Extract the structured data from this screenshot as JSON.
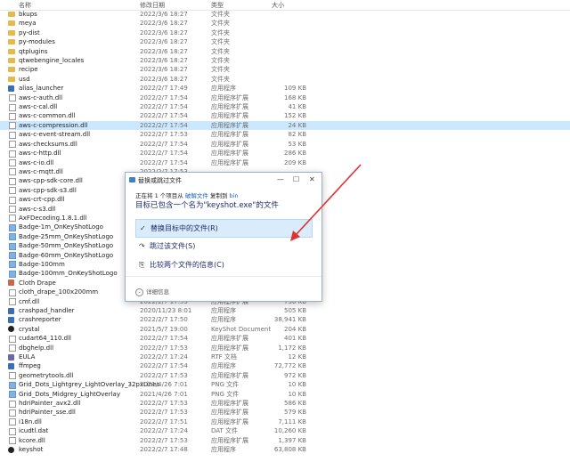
{
  "columns": {
    "name": "名称",
    "date": "修改日期",
    "type": "类型",
    "size": "大小"
  },
  "files": [
    {
      "name": "bkups",
      "date": "2022/3/6 18:27",
      "type": "文件夹",
      "size": "",
      "icon": "folder"
    },
    {
      "name": "meya",
      "date": "2022/3/6 18:27",
      "type": "文件夹",
      "size": "",
      "icon": "folder"
    },
    {
      "name": "py-dist",
      "date": "2022/3/6 18:27",
      "type": "文件夹",
      "size": "",
      "icon": "folder"
    },
    {
      "name": "py-modules",
      "date": "2022/3/6 18:27",
      "type": "文件夹",
      "size": "",
      "icon": "folder"
    },
    {
      "name": "qtplugins",
      "date": "2022/3/6 18:27",
      "type": "文件夹",
      "size": "",
      "icon": "folder"
    },
    {
      "name": "qtwebengine_locales",
      "date": "2022/3/6 18:27",
      "type": "文件夹",
      "size": "",
      "icon": "folder"
    },
    {
      "name": "recipe",
      "date": "2022/3/6 18:27",
      "type": "文件夹",
      "size": "",
      "icon": "folder"
    },
    {
      "name": "usd",
      "date": "2022/3/6 18:27",
      "type": "文件夹",
      "size": "",
      "icon": "folder"
    },
    {
      "name": "alias_launcher",
      "date": "2022/2/7 17:49",
      "type": "应用程序",
      "size": "109 KB",
      "icon": "exe"
    },
    {
      "name": "aws-c-auth.dll",
      "date": "2022/2/7 17:54",
      "type": "应用程序扩展",
      "size": "168 KB",
      "icon": "file"
    },
    {
      "name": "aws-c-cal.dll",
      "date": "2022/2/7 17:54",
      "type": "应用程序扩展",
      "size": "41 KB",
      "icon": "file"
    },
    {
      "name": "aws-c-common.dll",
      "date": "2022/2/7 17:54",
      "type": "应用程序扩展",
      "size": "152 KB",
      "icon": "file"
    },
    {
      "name": "aws-c-compression.dll",
      "date": "2022/2/7 17:54",
      "type": "应用程序扩展",
      "size": "24 KB",
      "icon": "file",
      "selected": true
    },
    {
      "name": "aws-c-event-stream.dll",
      "date": "2022/2/7 17:53",
      "type": "应用程序扩展",
      "size": "82 KB",
      "icon": "file"
    },
    {
      "name": "aws-checksums.dll",
      "date": "2022/2/7 17:54",
      "type": "应用程序扩展",
      "size": "53 KB",
      "icon": "file"
    },
    {
      "name": "aws-c-http.dll",
      "date": "2022/2/7 17:54",
      "type": "应用程序扩展",
      "size": "286 KB",
      "icon": "file"
    },
    {
      "name": "aws-c-io.dll",
      "date": "2022/2/7 17:54",
      "type": "应用程序扩展",
      "size": "209 KB",
      "icon": "file"
    },
    {
      "name": "aws-c-mqtt.dll",
      "date": "2022/2/7 17:53",
      "type": "",
      "size": "",
      "icon": "file"
    },
    {
      "name": "aws-cpp-sdk-core.dll",
      "date": "",
      "type": "",
      "size": "",
      "icon": "file"
    },
    {
      "name": "aws-cpp-sdk-s3.dll",
      "date": "",
      "type": "",
      "size": "",
      "icon": "file"
    },
    {
      "name": "aws-crt-cpp.dll",
      "date": "",
      "type": "",
      "size": "",
      "icon": "file"
    },
    {
      "name": "aws-c-s3.dll",
      "date": "",
      "type": "",
      "size": "",
      "icon": "file"
    },
    {
      "name": "AxFDecoding.1.8.1.dll",
      "date": "",
      "type": "",
      "size": "",
      "icon": "file"
    },
    {
      "name": "Badge-1m_OnKeyShotLogo",
      "date": "",
      "type": "",
      "size": "",
      "icon": "png"
    },
    {
      "name": "Badge-25mm_OnKeyShotLogo",
      "date": "",
      "type": "",
      "size": "",
      "icon": "png"
    },
    {
      "name": "Badge-50mm_OnKeyShotLogo",
      "date": "",
      "type": "",
      "size": "",
      "icon": "png"
    },
    {
      "name": "Badge-60mm_OnKeyShotLogo",
      "date": "",
      "type": "",
      "size": "",
      "icon": "png"
    },
    {
      "name": "Badge-100mm",
      "date": "",
      "type": "",
      "size": "",
      "icon": "png"
    },
    {
      "name": "Badge-100mm_OnKeyShotLogo",
      "date": "",
      "type": "",
      "size": "",
      "icon": "png"
    },
    {
      "name": "Cloth Drape",
      "date": "",
      "type": "",
      "size": "",
      "icon": "img"
    },
    {
      "name": "cloth_drape_100x200mm",
      "date": "",
      "type": "",
      "size": "",
      "icon": "file"
    },
    {
      "name": "cmf.dll",
      "date": "2022/2/7 17:53",
      "type": "应用程序扩展",
      "size": "736 KB",
      "icon": "file"
    },
    {
      "name": "crashpad_handler",
      "date": "2020/11/23 8:01",
      "type": "应用程序",
      "size": "505 KB",
      "icon": "exe"
    },
    {
      "name": "crashreporter",
      "date": "2022/2/7 17:50",
      "type": "应用程序",
      "size": "38,941 KB",
      "icon": "exe"
    },
    {
      "name": "crystal",
      "date": "2021/5/7 19:00",
      "type": "KeyShot Document",
      "size": "204 KB",
      "icon": "ks"
    },
    {
      "name": "cudart64_110.dll",
      "date": "2022/2/7 17:54",
      "type": "应用程序扩展",
      "size": "401 KB",
      "icon": "file"
    },
    {
      "name": "dbghelp.dll",
      "date": "2022/2/7 17:53",
      "type": "应用程序扩展",
      "size": "1,172 KB",
      "icon": "file"
    },
    {
      "name": "EULA",
      "date": "2022/2/7 17:24",
      "type": "RTF 文档",
      "size": "12 KB",
      "icon": "doc"
    },
    {
      "name": "ffmpeg",
      "date": "2022/2/7 17:54",
      "type": "应用程序",
      "size": "72,772 KB",
      "icon": "exe"
    },
    {
      "name": "geometrytools.dll",
      "date": "2022/2/7 17:53",
      "type": "应用程序扩展",
      "size": "972 KB",
      "icon": "file"
    },
    {
      "name": "Grid_Dots_Lightgrey_LightOverlay_32pxLines",
      "date": "2021/4/26 7:01",
      "type": "PNG 文件",
      "size": "10 KB",
      "icon": "png"
    },
    {
      "name": "Grid_Dots_Midgrey_LightOverlay",
      "date": "2021/4/26 7:01",
      "type": "PNG 文件",
      "size": "10 KB",
      "icon": "png"
    },
    {
      "name": "hdriPainter_avx2.dll",
      "date": "2022/2/7 17:53",
      "type": "应用程序扩展",
      "size": "586 KB",
      "icon": "file"
    },
    {
      "name": "hdriPainter_sse.dll",
      "date": "2022/2/7 17:53",
      "type": "应用程序扩展",
      "size": "579 KB",
      "icon": "file"
    },
    {
      "name": "i18n.dll",
      "date": "2022/2/7 17:51",
      "type": "应用程序扩展",
      "size": "7,111 KB",
      "icon": "file"
    },
    {
      "name": "icudtl.dat",
      "date": "2022/2/7 17:24",
      "type": "DAT 文件",
      "size": "10,260 KB",
      "icon": "file"
    },
    {
      "name": "kcore.dll",
      "date": "2022/2/7 17:53",
      "type": "应用程序扩展",
      "size": "1,397 KB",
      "icon": "file"
    },
    {
      "name": "keyshot",
      "date": "2022/2/7 17:48",
      "type": "应用程序",
      "size": "63,808 KB",
      "icon": "ks"
    }
  ],
  "dialog": {
    "title": "替换或跳过文件",
    "progress_prefix": "正在将 1 个项目从",
    "source": "破解文件",
    "copy_to": "复制到",
    "destination": "bin",
    "heading": "目标已包含一个名为\"keyshot.exe\"的文件",
    "option_replace": "替换目标中的文件(R)",
    "option_skip": "跳过该文件(S)",
    "option_compare": "比较两个文件的信息(C)",
    "details": "详细信息",
    "minimize": "—",
    "maximize": "☐",
    "close": "✕"
  },
  "colors": {
    "annotation_arrow": "#e03232",
    "selection": "#cce8ff",
    "link": "#1a63c3"
  }
}
